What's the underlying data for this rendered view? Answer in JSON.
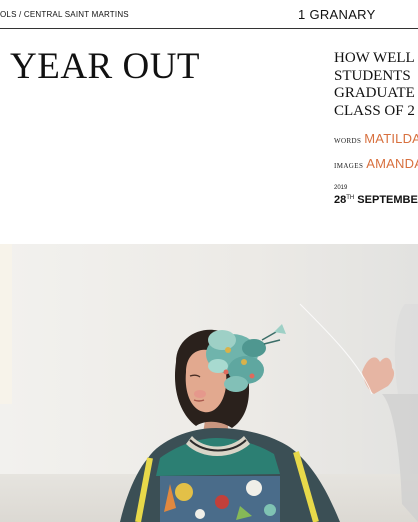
{
  "topbar": {
    "breadcrumb": "OLS / CENTRAL SAINT MARTINS",
    "brand": "1 GRANARY"
  },
  "article": {
    "title": "YEAR OUT",
    "dek_lines": [
      "HOW WELL",
      "STUDENTS",
      "GRADUATE",
      "CLASS OF 2"
    ],
    "words_label": "WORDS",
    "words_author": "MATILDA",
    "images_label": "IMAGES",
    "images_author": "AMANDA",
    "year": "2019",
    "date_day": "28",
    "date_suffix": "TH",
    "date_rest": " SEPTEMBE"
  },
  "hero": {
    "image": "portrait-with-floral-headpiece",
    "colors": {
      "background": "#ececea",
      "accent": "#d8703e",
      "headpiece": "#5fa7a0",
      "hair": "#2a211c"
    }
  }
}
